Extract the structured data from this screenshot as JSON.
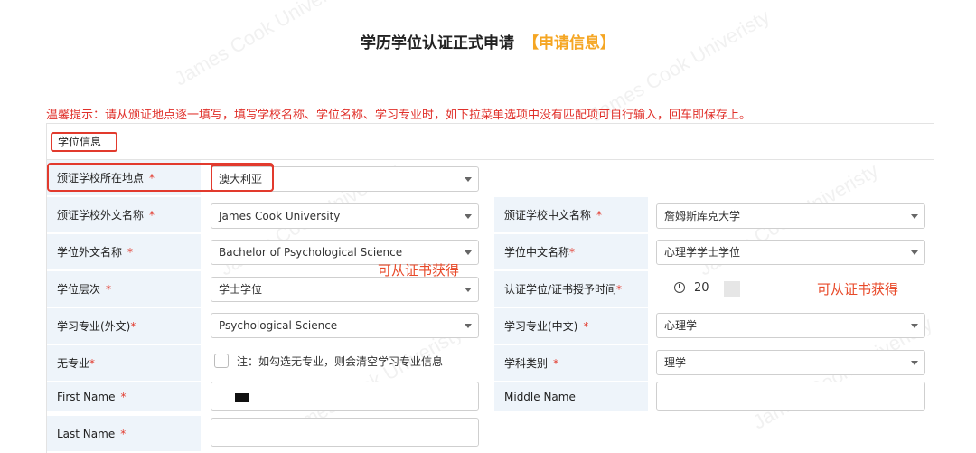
{
  "page": {
    "title": "学历学位认证正式申请",
    "title_tag": "【申请信息】",
    "hint": "温馨提示：请从颁证地点逐一填写，填写学校名称、学位名称、学习专业时，如下拉菜单选项中没有匹配项可自行输入，回车即保存上。",
    "section": "学位信息",
    "watermark_text": "James Cook Univeristy"
  },
  "fields": {
    "location": {
      "label": "颁证学校所在地点",
      "value": "澳大利亚"
    },
    "school_foreign": {
      "label": "颁证学校外文名称",
      "value": "James Cook University"
    },
    "school_cn": {
      "label": "颁证学校中文名称",
      "value": "詹姆斯库克大学"
    },
    "degree_foreign": {
      "label": "学位外文名称",
      "value": "Bachelor of Psychological Science"
    },
    "degree_cn": {
      "label": "学位中文名称",
      "value": "心理学学士学位"
    },
    "degree_level": {
      "label": "学位层次",
      "value": "学士学位"
    },
    "award_time": {
      "label": "认证学位/证书授予时间",
      "value": "20"
    },
    "major_foreign": {
      "label": "学习专业(外文)",
      "value": "Psychological Science"
    },
    "major_cn": {
      "label": "学习专业(中文)",
      "value": "心理学"
    },
    "no_major": {
      "label": "无专业",
      "note": "注：如勾选无专业，则会清空学习专业信息"
    },
    "category": {
      "label": "学科类别",
      "value": "理学"
    },
    "first_name": {
      "label": "First Name",
      "value": ""
    },
    "middle_name": {
      "label": "Middle Name",
      "value": ""
    },
    "last_name": {
      "label": "Last Name",
      "value": ""
    }
  },
  "annotations": {
    "from_cert_1": "可从证书获得",
    "from_cert_2": "可从证书获得"
  },
  "colors": {
    "required": "#e23a2d",
    "accent": "#f5a623",
    "label_bg": "#eef4fa",
    "annotation": "#e84a2a"
  }
}
